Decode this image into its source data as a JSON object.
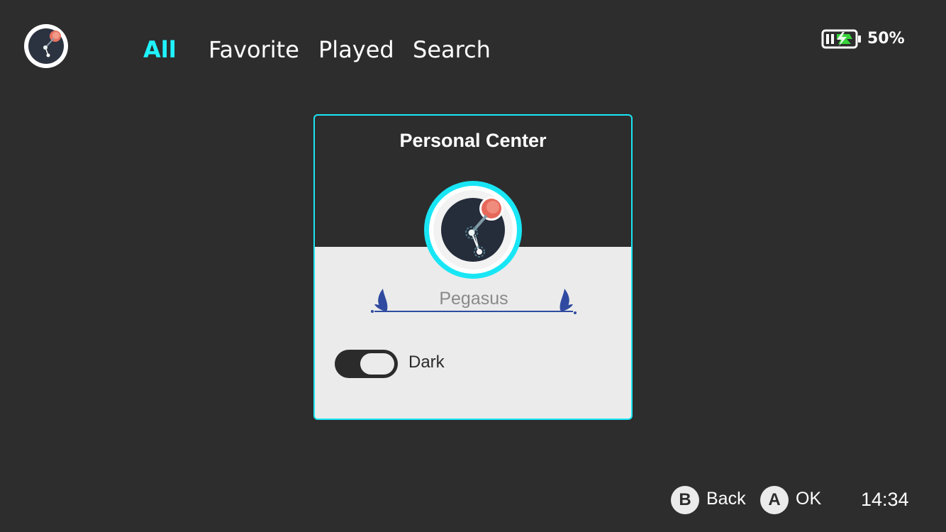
{
  "header": {
    "avatar_icon": "avatar-icon",
    "tabs": [
      {
        "label": "All",
        "active": true
      },
      {
        "label": "Favorite",
        "active": false
      },
      {
        "label": "Played",
        "active": false
      },
      {
        "label": "Search",
        "active": false
      }
    ],
    "battery": {
      "icon": "battery-charging-icon",
      "percent_text": "50%",
      "level": 0.5,
      "charge_color": "#37d33b"
    }
  },
  "card": {
    "title": "Personal Center",
    "avatar_icon": "profile-avatar-icon",
    "username": "Pegasus",
    "theme_toggle": {
      "label": "Dark",
      "on": true
    },
    "accent_color": "#19e6f5"
  },
  "footer": {
    "back": {
      "button": "B",
      "label": "Back"
    },
    "ok": {
      "button": "A",
      "label": "OK"
    },
    "time": "14:34"
  },
  "colors": {
    "background": "#2d2d2d",
    "active_tab": "#1ff3ff",
    "panel": "#ebebeb"
  }
}
